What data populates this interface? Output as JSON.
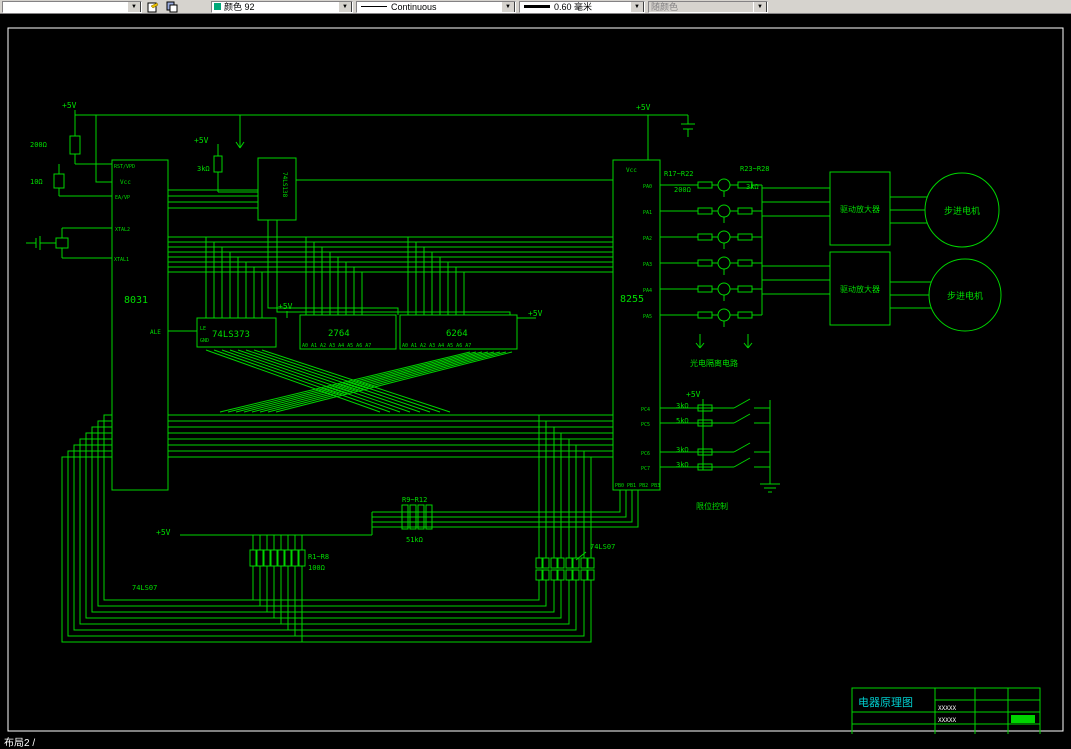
{
  "toolbar": {
    "layer_combo": {
      "value": ""
    },
    "color_combo": {
      "value": "颜色 92",
      "swatch_color": "#00a878"
    },
    "linetype_combo": {
      "value": "Continuous"
    },
    "lineweight_combo": {
      "value": "0.60 毫米"
    },
    "plotstyle_combo": {
      "value": "随颜色"
    }
  },
  "statusbar": {
    "layout_tab": "布局2 /"
  },
  "colors": {
    "wire": "#00d400",
    "text": "#00dd00",
    "sheet_border": "#ffffff",
    "title_text": "#00cfcf"
  },
  "schematic": {
    "chips": {
      "mcu": "8031",
      "decoder": "74LS138",
      "latch": "74LS373",
      "eprom": "2764",
      "sram": "6264",
      "ppi": "8255"
    },
    "mcu_pins": {
      "rst": "RST/VPD",
      "vcc": "Vcc",
      "ea": "EA/VP",
      "xtal2": "XTAL2",
      "xtal1": "XTAL1",
      "ale": "ALE",
      "le": "LE",
      "gnd": "GND"
    },
    "ppi_pins": {
      "vcc": "Vcc",
      "pa": [
        "PA0",
        "PA1",
        "PA2",
        "PA3",
        "PA4",
        "PA5"
      ],
      "pc": [
        "PC4",
        "PC5",
        "PC6",
        "PC7"
      ],
      "pb": "PB0 PB1 PB2 PB3"
    },
    "labels": {
      "p5v": "+5V",
      "r200": "200Ω",
      "r10": "10Ω",
      "r3k": "3kΩ",
      "r5k": "5kΩ",
      "r51k": "51kΩ",
      "r100": "100Ω",
      "r9_12": "R9~R12",
      "r1_8": "R1~R8",
      "r17_22": "R17~R22",
      "r23_28": "R23~R28",
      "opto_caption": "光电隔离电路",
      "limit_caption": "限位控制",
      "driver": "驱动放大器",
      "motor": "步进电机",
      "buffer": "74LS07",
      "addr_row": "A0 A1 A2 A3 A4 A5 A6 A7"
    },
    "titleblock": {
      "title": "电器原理图",
      "no1": "XXXXX",
      "no2": "XXXXX"
    }
  }
}
